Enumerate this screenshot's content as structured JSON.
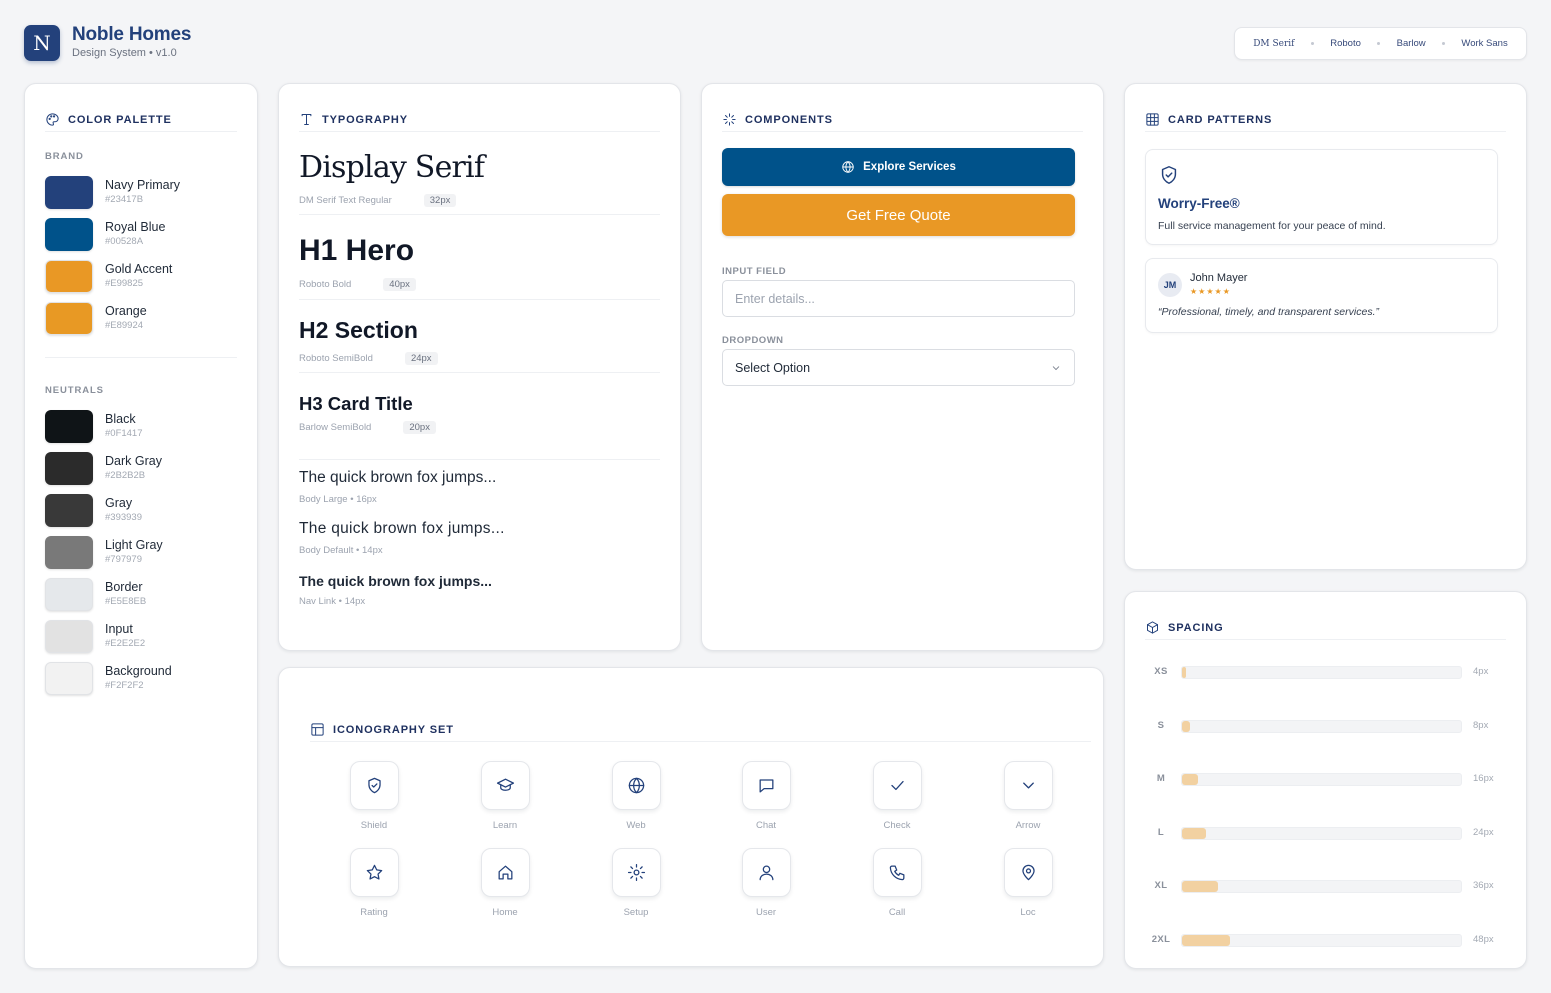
{
  "header": {
    "logo_letter": "N",
    "brand_name": "Noble Homes",
    "brand_sub": "Design System • v1.0",
    "fonts": [
      "DM Serif",
      "Roboto",
      "Barlow",
      "Work Sans"
    ]
  },
  "palette": {
    "title": "COLOR PALETTE",
    "brand_label": "BRAND",
    "brand": [
      {
        "name": "Navy Primary",
        "hex": "#23417B"
      },
      {
        "name": "Royal Blue",
        "hex": "#00528A"
      },
      {
        "name": "Gold Accent",
        "hex": "#E99825"
      },
      {
        "name": "Orange",
        "hex": "#E89924"
      }
    ],
    "neutrals_label": "NEUTRALS",
    "neutrals": [
      {
        "name": "Black",
        "hex": "#0F1417"
      },
      {
        "name": "Dark Gray",
        "hex": "#2B2B2B"
      },
      {
        "name": "Gray",
        "hex": "#393939"
      },
      {
        "name": "Light Gray",
        "hex": "#797979"
      },
      {
        "name": "Border",
        "hex": "#E5E8EB"
      },
      {
        "name": "Input",
        "hex": "#E2E2E2"
      },
      {
        "name": "Background",
        "hex": "#F2F2F2"
      }
    ]
  },
  "typography": {
    "title": "TYPOGRAPHY",
    "display": {
      "text": "Display Serif",
      "font": "DM Serif Text Regular",
      "size": "32px"
    },
    "h1": {
      "text": "H1 Hero",
      "font": "Roboto Bold",
      "size": "40px"
    },
    "h2": {
      "text": "H2 Section",
      "font": "Roboto SemiBold",
      "size": "24px"
    },
    "h3": {
      "text": "H3 Card Title",
      "font": "Barlow SemiBold",
      "size": "20px"
    },
    "body_large": {
      "text": "The quick brown fox jumps...",
      "meta": "Body Large • 16px"
    },
    "body_default": {
      "text": "The quick brown fox jumps...",
      "meta": "Body Default • 14px"
    },
    "nav_link": {
      "text": "The quick brown fox jumps...",
      "meta": "Nav Link • 14px"
    }
  },
  "components": {
    "title": "COMPONENTS",
    "primary_button": "Explore Services",
    "gold_button": "Get Free Quote",
    "input_label": "INPUT FIELD",
    "input_placeholder": "Enter details...",
    "dropdown_label": "DROPDOWN",
    "dropdown_value": "Select Option"
  },
  "cards": {
    "title": "CARD PATTERNS",
    "feature": {
      "title": "Worry-Free®",
      "text": "Full service management for your peace of mind."
    },
    "testimonial": {
      "initials": "JM",
      "name": "John Mayer",
      "stars": "★★★★★",
      "rating": 5,
      "quote": "“Professional, timely, and transparent services.”"
    }
  },
  "spacing": {
    "title": "SPACING",
    "items": [
      {
        "label": "XS",
        "value": "4px",
        "size": 4
      },
      {
        "label": "S",
        "value": "8px",
        "size": 8
      },
      {
        "label": "M",
        "value": "16px",
        "size": 16
      },
      {
        "label": "L",
        "value": "24px",
        "size": 24
      },
      {
        "label": "XL",
        "value": "36px",
        "size": 36
      },
      {
        "label": "2XL",
        "value": "48px",
        "size": 48
      }
    ]
  },
  "icons": {
    "title": "ICONOGRAPHY SET",
    "items": [
      {
        "label": "Shield",
        "icon": "shield-icon"
      },
      {
        "label": "Learn",
        "icon": "graduation-cap-icon"
      },
      {
        "label": "Web",
        "icon": "globe-icon"
      },
      {
        "label": "Chat",
        "icon": "chat-icon"
      },
      {
        "label": "Check",
        "icon": "check-icon"
      },
      {
        "label": "Arrow",
        "icon": "chevron-down-icon"
      },
      {
        "label": "Rating",
        "icon": "star-icon"
      },
      {
        "label": "Home",
        "icon": "home-icon"
      },
      {
        "label": "Setup",
        "icon": "gear-icon"
      },
      {
        "label": "User",
        "icon": "user-icon"
      },
      {
        "label": "Call",
        "icon": "phone-icon"
      },
      {
        "label": "Loc",
        "icon": "map-pin-icon"
      }
    ]
  }
}
